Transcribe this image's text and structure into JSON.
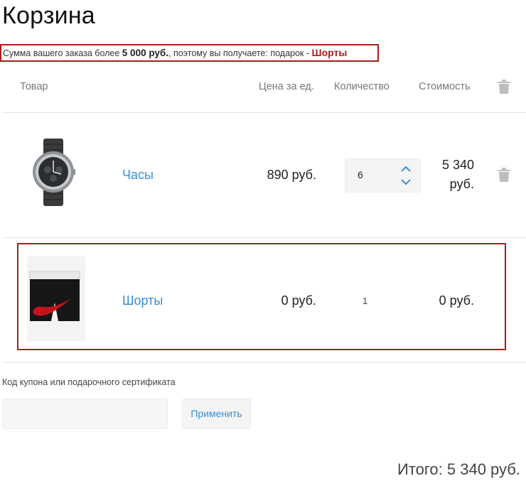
{
  "page": {
    "title": "Корзина"
  },
  "notice": {
    "prefix": "Сумма вашего заказа более ",
    "threshold": "5 000 руб.",
    "middle": ", поэтому вы получаете: подарок - ",
    "gift": "Шорты"
  },
  "table": {
    "headers": {
      "product": "Товар",
      "price": "Цена за ед.",
      "qty": "Количество",
      "cost": "Стоимость"
    },
    "trash_icon": "trash-icon"
  },
  "items": [
    {
      "name": "Часы",
      "price": "890 руб.",
      "qty": "6",
      "cost_line1": "5 340",
      "cost_line2": "руб."
    },
    {
      "name": "Шорты",
      "price": "0 руб.",
      "qty": "1",
      "cost": "0 руб."
    }
  ],
  "coupon": {
    "label": "Код купона или подарочного сертификата",
    "value": "",
    "placeholder": "",
    "apply_label": "Применить"
  },
  "total": {
    "text": "Итого: 5 340 руб."
  },
  "colors": {
    "accent": "#3b8dd1",
    "highlight": "#a61f1f",
    "muted": "#777777"
  }
}
